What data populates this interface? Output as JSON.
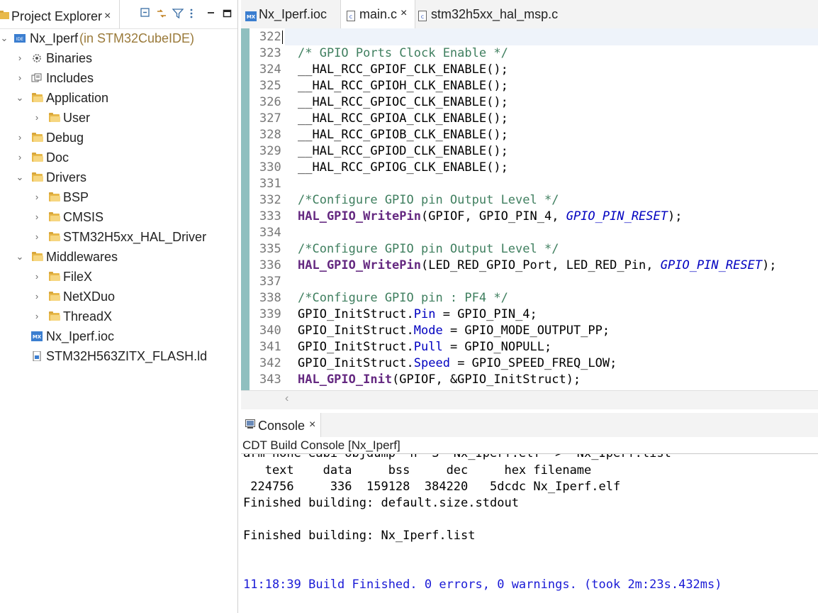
{
  "project_explorer": {
    "tab_label": "Project Explorer",
    "close_glyph": "×",
    "root": {
      "name": "Nx_Iperf",
      "suffix": "(in STM32CubeIDE)"
    },
    "items": [
      {
        "label": "Binaries"
      },
      {
        "label": "Includes"
      },
      {
        "label": "Application"
      },
      {
        "label": "User"
      },
      {
        "label": "Debug"
      },
      {
        "label": "Doc"
      },
      {
        "label": "Drivers"
      },
      {
        "label": "BSP"
      },
      {
        "label": "CMSIS"
      },
      {
        "label": "STM32H5xx_HAL_Driver"
      },
      {
        "label": "Middlewares"
      },
      {
        "label": "FileX"
      },
      {
        "label": "NetXDuo"
      },
      {
        "label": "ThreadX"
      },
      {
        "label": "Nx_Iperf.ioc"
      },
      {
        "label": "STM32H563ZITX_FLASH.ld"
      }
    ]
  },
  "editor": {
    "tabs": [
      {
        "label": "Nx_Iperf.ioc",
        "icon_text": "MX"
      },
      {
        "label": "main.c",
        "close": "×"
      },
      {
        "label": "stm32h5xx_hal_msp.c"
      }
    ],
    "line_numbers": [
      "322",
      "323",
      "324",
      "325",
      "326",
      "327",
      "328",
      "329",
      "330",
      "331",
      "332",
      "333",
      "334",
      "335",
      "336",
      "337",
      "338",
      "339",
      "340",
      "341",
      "342",
      "343"
    ],
    "lines": {
      "l323": "/* GPIO Ports Clock Enable */",
      "l324": "__HAL_RCC_GPIOF_CLK_ENABLE();",
      "l325": "__HAL_RCC_GPIOH_CLK_ENABLE();",
      "l326": "__HAL_RCC_GPIOC_CLK_ENABLE();",
      "l327": "__HAL_RCC_GPIOA_CLK_ENABLE();",
      "l328": "__HAL_RCC_GPIOB_CLK_ENABLE();",
      "l329": "__HAL_RCC_GPIOD_CLK_ENABLE();",
      "l330": "__HAL_RCC_GPIOG_CLK_ENABLE();",
      "l332": "/*Configure GPIO pin Output Level */",
      "l333": {
        "fn": "HAL_GPIO_WritePin",
        "args": "(GPIOF, GPIO_PIN_4, ",
        "enum": "GPIO_PIN_RESET",
        "end": ");"
      },
      "l335": "/*Configure GPIO pin Output Level */",
      "l336": {
        "fn": "HAL_GPIO_WritePin",
        "args": "(LED_RED_GPIO_Port, LED_RED_Pin, ",
        "enum": "GPIO_PIN_RESET",
        "end": ");"
      },
      "l338": "/*Configure GPIO pin : PF4 */",
      "l339": {
        "pre": "GPIO_InitStruct.",
        "field": "Pin",
        "post": " = GPIO_PIN_4;"
      },
      "l340": {
        "pre": "GPIO_InitStruct.",
        "field": "Mode",
        "post": " = GPIO_MODE_OUTPUT_PP;"
      },
      "l341": {
        "pre": "GPIO_InitStruct.",
        "field": "Pull",
        "post": " = GPIO_NOPULL;"
      },
      "l342": {
        "pre": "GPIO_InitStruct.",
        "field": "Speed",
        "post": " = GPIO_SPEED_FREQ_LOW;"
      },
      "l343": {
        "fn": "HAL_GPIO_Init",
        "args": "(GPIOF, &GPIO_InitStruct);"
      }
    }
  },
  "console": {
    "tab_label": "Console",
    "close_glyph": "×",
    "title": "CDT Build Console [Nx_Iperf]",
    "lines": {
      "partial": "arm-none-eabi-objdump -h -S  Nx_Iperf.elf  >  Nx_Iperf.list",
      "header": "   text    data     bss     dec     hex filename",
      "values": " 224756     336  159128  384220   5dcdc Nx_Iperf.elf",
      "finished1": "Finished building: default.size.stdout",
      "finished2": "Finished building: Nx_Iperf.list",
      "build": "11:18:39 Build Finished. 0 errors, 0 warnings. (took 2m:23s.432ms)"
    },
    "build_color": "#1a1ad6"
  }
}
